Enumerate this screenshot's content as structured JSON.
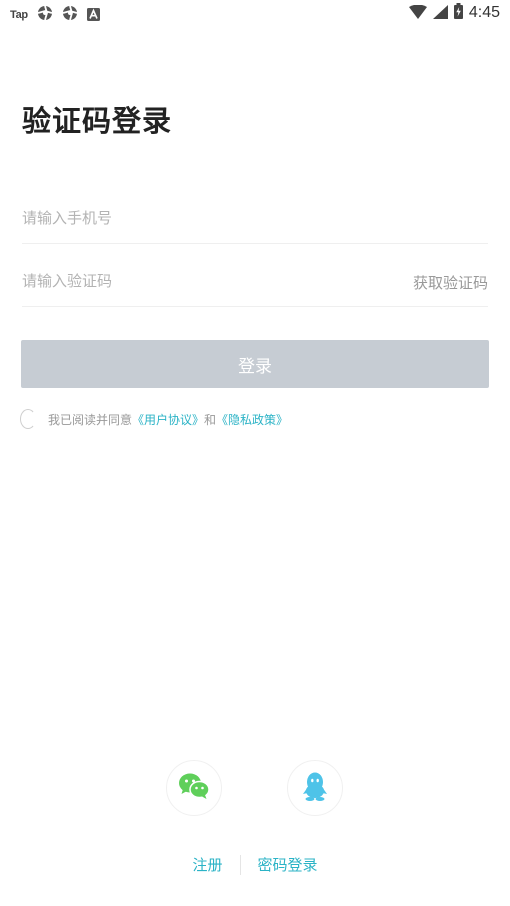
{
  "status_bar": {
    "app_label": "Tap",
    "time": "4:45"
  },
  "page": {
    "title": "验证码登录"
  },
  "form": {
    "phone_placeholder": "请输入手机号",
    "code_placeholder": "请输入验证码",
    "get_code_label": "获取验证码",
    "login_label": "登录"
  },
  "agreement": {
    "prefix": "我已阅读并同意",
    "user_agreement": "《用户协议》",
    "connector": "和",
    "privacy_policy": "《隐私政策》"
  },
  "social": {
    "wechat_icon": "wechat-icon",
    "qq_icon": "qq-icon"
  },
  "bottom": {
    "register_label": "注册",
    "password_login_label": "密码登录"
  },
  "colors": {
    "accent": "#2bb3c6",
    "button_disabled": "#c6ccd3",
    "wechat": "#5fcf5a",
    "qq": "#4ec3e8"
  }
}
